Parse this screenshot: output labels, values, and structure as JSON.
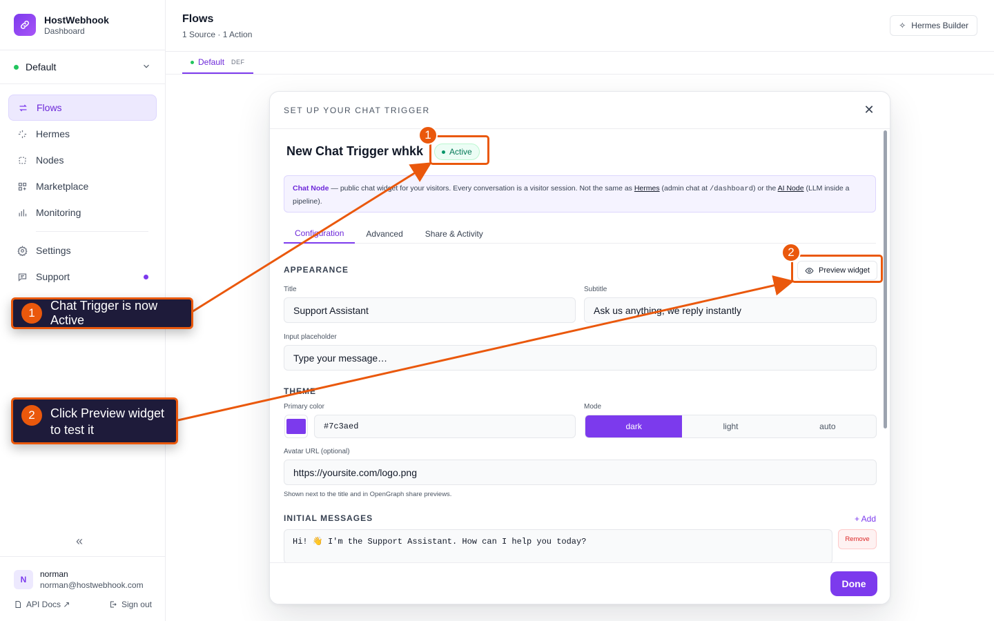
{
  "brand": {
    "name": "HostWebhook",
    "subtitle": "Dashboard"
  },
  "workspace": {
    "name": "Default"
  },
  "nav": {
    "items": [
      {
        "label": "Flows",
        "icon": "flows-icon",
        "active": true
      },
      {
        "label": "Hermes",
        "icon": "sparkles-icon"
      },
      {
        "label": "Nodes",
        "icon": "nodes-icon"
      },
      {
        "label": "Marketplace",
        "icon": "marketplace-icon"
      },
      {
        "label": "Monitoring",
        "icon": "monitoring-icon"
      }
    ],
    "secondary": [
      {
        "label": "Settings",
        "icon": "gear-icon"
      },
      {
        "label": "Support",
        "icon": "chat-icon"
      }
    ]
  },
  "user": {
    "initial": "N",
    "name": "norman",
    "email": "norman@hostwebhook.com",
    "api_docs": "API Docs ↗",
    "sign_out": "Sign out"
  },
  "header": {
    "title": "Flows",
    "subtitle": "1 Source · 1 Action",
    "hermes_builder": "Hermes Builder"
  },
  "subtab": {
    "label": "Default",
    "tag": "DEF"
  },
  "modal": {
    "title": "SET UP YOUR CHAT TRIGGER",
    "trigger_name": "New Chat Trigger whkk",
    "status": "Active",
    "info": {
      "strong": "Chat Node",
      "text1": " — public chat widget for your visitors. Every conversation is a visitor session. Not the same as ",
      "link1": "Hermes",
      "text2": " (admin chat at ",
      "code": "/dashboard",
      "text3": ") or the ",
      "link2": "AI Node",
      "text4": " (LLM inside a pipeline)."
    },
    "tabs": [
      "Configuration",
      "Advanced",
      "Share & Activity"
    ],
    "appearance": {
      "heading": "APPEARANCE",
      "preview_button": "Preview widget",
      "title_label": "Title",
      "title_value": "Support Assistant",
      "subtitle_label": "Subtitle",
      "subtitle_value": "Ask us anything, we reply instantly",
      "placeholder_label": "Input placeholder",
      "placeholder_value": "Type your message…"
    },
    "theme": {
      "heading": "THEME",
      "primary_label": "Primary color",
      "primary_value": "#7c3aed",
      "mode_label": "Mode",
      "modes": [
        "dark",
        "light",
        "auto"
      ],
      "selected_mode": "dark",
      "avatar_label": "Avatar URL (optional)",
      "avatar_value": "https://yoursite.com/logo.png",
      "avatar_hint": "Shown next to the title and in OpenGraph share previews."
    },
    "initial_messages": {
      "heading": "INITIAL MESSAGES",
      "add": "+ Add",
      "message": "Hi! 👋 I'm the Support Assistant. How can I help you today?",
      "remove": "Remove"
    },
    "done": "Done"
  },
  "annotations": [
    {
      "number": "1",
      "text": "Chat Trigger is now Active"
    },
    {
      "number": "2",
      "text": "Click Preview widget to test it"
    }
  ],
  "colors": {
    "accent": "#7c3aed",
    "annotation": "#ea580c",
    "callout_bg": "#1e1b3a",
    "success": "#22c55e"
  }
}
